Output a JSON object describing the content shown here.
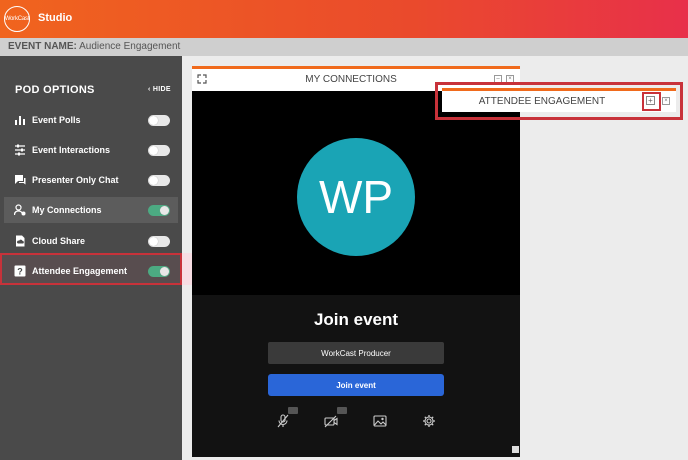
{
  "app": {
    "logo_text": "WorkCast",
    "title": "Studio"
  },
  "event": {
    "label": "EVENT NAME:",
    "name": "Audience Engagement"
  },
  "sidebar": {
    "title": "POD OPTIONS",
    "hide_label": "HIDE",
    "items": [
      {
        "label": "Event Polls",
        "icon": "bar-chart-icon",
        "enabled": false
      },
      {
        "label": "Event Interactions",
        "icon": "sliders-icon",
        "enabled": false
      },
      {
        "label": "Presenter Only Chat",
        "icon": "chat-icon",
        "enabled": false
      },
      {
        "label": "My Connections",
        "icon": "user-connections-icon",
        "enabled": true
      },
      {
        "label": "Cloud Share",
        "icon": "cloud-file-icon",
        "enabled": false
      },
      {
        "label": "Attendee Engagement",
        "icon": "question-icon",
        "enabled": true
      }
    ]
  },
  "connections_pod": {
    "title": "MY CONNECTIONS",
    "avatar_initials": "WP",
    "join_title": "Join event",
    "name_value": "WorkCast Producer",
    "join_button": "Join event"
  },
  "attendee_pod": {
    "title": "ATTENDEE ENGAGEMENT",
    "minimize_symbol": "+",
    "close_symbol": "×"
  },
  "colors": {
    "accent": "#f06a1c",
    "toggle_on": "#4caa82",
    "avatar": "#1aa4b5",
    "join_button": "#2a66d8",
    "highlight": "#c8323a"
  }
}
